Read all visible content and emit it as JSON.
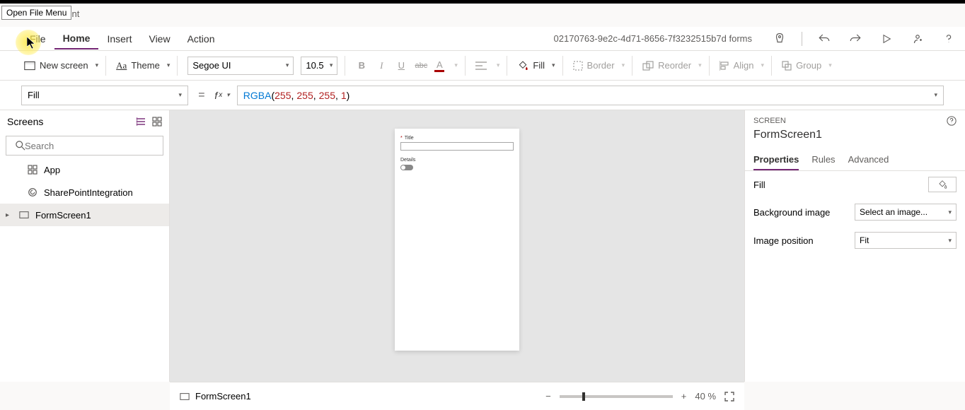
{
  "tooltip": "Open File Menu",
  "app_suite": "SharePoint",
  "tabs": {
    "file": "File",
    "home": "Home",
    "insert": "Insert",
    "view": "View",
    "action": "Action"
  },
  "doc_title": "02170763-9e2c-4d71-8656-7f3232515b7d forms",
  "ribbon": {
    "new_screen": "New screen",
    "theme": "Theme",
    "font": "Segoe UI",
    "size": "10.5",
    "fill": "Fill",
    "border": "Border",
    "reorder": "Reorder",
    "align": "Align",
    "group": "Group"
  },
  "formula": {
    "property": "Fill",
    "fn": "RGBA",
    "a1": "255",
    "a2": "255",
    "a3": "255",
    "a4": "1"
  },
  "tree": {
    "title": "Screens",
    "search_placeholder": "Search",
    "items": [
      "App",
      "SharePointIntegration",
      "FormScreen1"
    ]
  },
  "canvas_form": {
    "title_label": "Title",
    "details_label": "Details"
  },
  "props": {
    "category": "SCREEN",
    "name": "FormScreen1",
    "tabs": {
      "properties": "Properties",
      "rules": "Rules",
      "advanced": "Advanced"
    },
    "fill_label": "Fill",
    "bgimage_label": "Background image",
    "bgimage_value": "Select an image...",
    "imgpos_label": "Image position",
    "imgpos_value": "Fit"
  },
  "status": {
    "screen": "FormScreen1",
    "zoom": "40",
    "pct": "%"
  }
}
